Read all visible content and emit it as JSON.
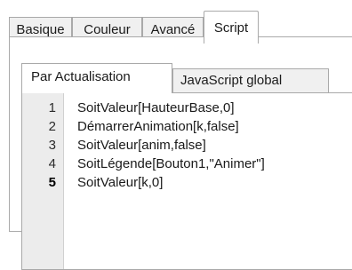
{
  "main_tabs": [
    {
      "label": "Basique",
      "active": false
    },
    {
      "label": "Couleur",
      "active": false
    },
    {
      "label": "Avancé",
      "active": false
    },
    {
      "label": "Script",
      "active": true
    }
  ],
  "script_tabs": [
    {
      "label": "Par Actualisation",
      "active": true
    },
    {
      "label": "JavaScript global",
      "active": false
    }
  ],
  "editor": {
    "current_line": 5,
    "lines": [
      {
        "num": "1",
        "code": "SoitValeur[HauteurBase,0]"
      },
      {
        "num": "2",
        "code": "DémarrerAnimation[k,false]"
      },
      {
        "num": "3",
        "code": "SoitValeur[anim,false]"
      },
      {
        "num": "4",
        "code": "SoitLégende[Bouton1,\"Animer\"]"
      },
      {
        "num": "5",
        "code": "SoitValeur[k,0]"
      }
    ]
  },
  "colors": {
    "tab_inactive_bg": "#f0f0f0",
    "tab_border": "#a9a9a9",
    "gutter_bg": "#ececec",
    "panel_bg": "#ffffff"
  }
}
